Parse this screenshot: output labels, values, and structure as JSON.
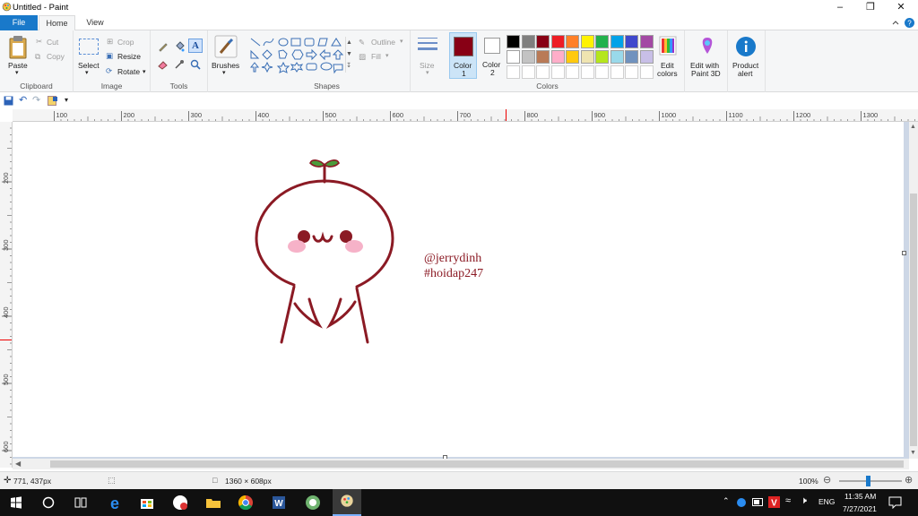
{
  "window": {
    "title": "Untitled - Paint"
  },
  "tabs": {
    "file": "File",
    "home": "Home",
    "view": "View"
  },
  "clipboard": {
    "paste": "Paste",
    "cut": "Cut",
    "copy": "Copy",
    "group": "Clipboard"
  },
  "image": {
    "select": "Select",
    "crop": "Crop",
    "resize": "Resize",
    "rotate": "Rotate",
    "group": "Image"
  },
  "tools": {
    "group": "Tools",
    "brushes": "Brushes"
  },
  "shapes": {
    "outline": "Outline",
    "fill": "Fill",
    "group": "Shapes"
  },
  "colors": {
    "size": "Size",
    "color1": "Color",
    "color1_num": "1",
    "color2": "Color",
    "color2_num": "2",
    "edit": "Edit",
    "edit2": "colors",
    "group": "Colors",
    "color1_value": "#880015",
    "palette_row1": [
      "#000000",
      "#7f7f7f",
      "#880015",
      "#ed1c24",
      "#ff7f27",
      "#fff200",
      "#22b14c",
      "#00a2e8",
      "#3f48cc",
      "#a349a4"
    ],
    "palette_row2": [
      "#ffffff",
      "#c3c3c3",
      "#b97a57",
      "#ffaec9",
      "#ffc90e",
      "#efe4b0",
      "#b5e61d",
      "#99d9ea",
      "#7092be",
      "#c8bfe7"
    ]
  },
  "paint3d": {
    "line1": "Edit with",
    "line2": "Paint 3D"
  },
  "product": {
    "line1": "Product",
    "line2": "alert"
  },
  "ruler": {
    "h": [
      "100",
      "200",
      "300",
      "400",
      "500",
      "600",
      "700",
      "800",
      "900",
      "1000",
      "1100",
      "1200",
      "1300"
    ],
    "v": [
      "200",
      "300",
      "400",
      "500",
      "600"
    ]
  },
  "canvas_text": {
    "line1": "@jerrydinh",
    "line2": "#hoidap247"
  },
  "status": {
    "cursor": "771, 437px",
    "size": "1360 × 608px",
    "zoom": "100%"
  },
  "clock": {
    "time": "11:35 AM",
    "date": "7/27/2021"
  },
  "tray": {
    "lang": "ENG"
  }
}
